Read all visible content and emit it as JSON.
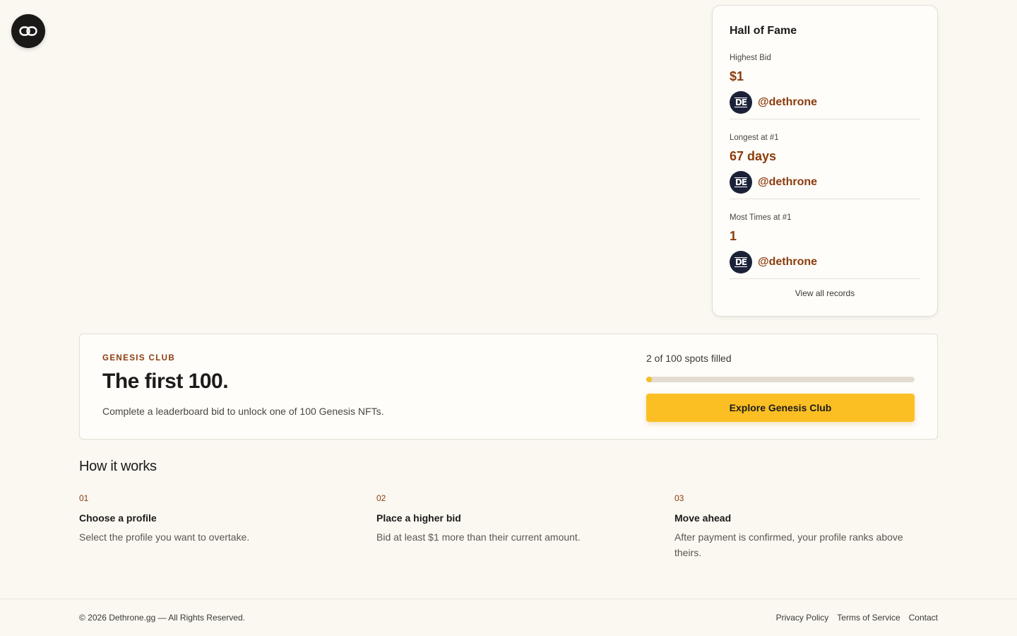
{
  "logo": {
    "icon": "infinity-link-icon"
  },
  "hall_of_fame": {
    "title": "Hall of Fame",
    "records": [
      {
        "label": "Highest Bid",
        "value": "$1",
        "avatar": "DE",
        "holder": "@dethrone"
      },
      {
        "label": "Longest at #1",
        "value": "67 days",
        "avatar": "DE",
        "holder": "@dethrone"
      },
      {
        "label": "Most Times at #1",
        "value": "1",
        "avatar": "DE",
        "holder": "@dethrone"
      }
    ],
    "view_all": "View all records"
  },
  "genesis": {
    "eyebrow": "GENESIS CLUB",
    "title": "The first 100.",
    "description": "Complete a leaderboard bid to unlock one of 100 Genesis NFTs.",
    "spots_text": "2 of 100 spots filled",
    "filled": 2,
    "total": 100,
    "button_label": "Explore Genesis Club"
  },
  "how_it_works": {
    "title": "How it works",
    "steps": [
      {
        "num": "01",
        "title": "Choose a profile",
        "desc": "Select the profile you want to overtake."
      },
      {
        "num": "02",
        "title": "Place a higher bid",
        "desc": "Bid at least $1 more than their current amount."
      },
      {
        "num": "03",
        "title": "Move ahead",
        "desc": "After payment is confirmed, your profile ranks above theirs."
      }
    ]
  },
  "footer": {
    "copyright": "© 2026 Dethrone.gg — All Rights Reserved.",
    "links": [
      "Privacy Policy",
      "Terms of Service",
      "Contact"
    ]
  },
  "colors": {
    "background": "#fbf8f2",
    "accent": "#8a3c0c",
    "button": "#fbbf24",
    "avatar": "#1b2238"
  }
}
